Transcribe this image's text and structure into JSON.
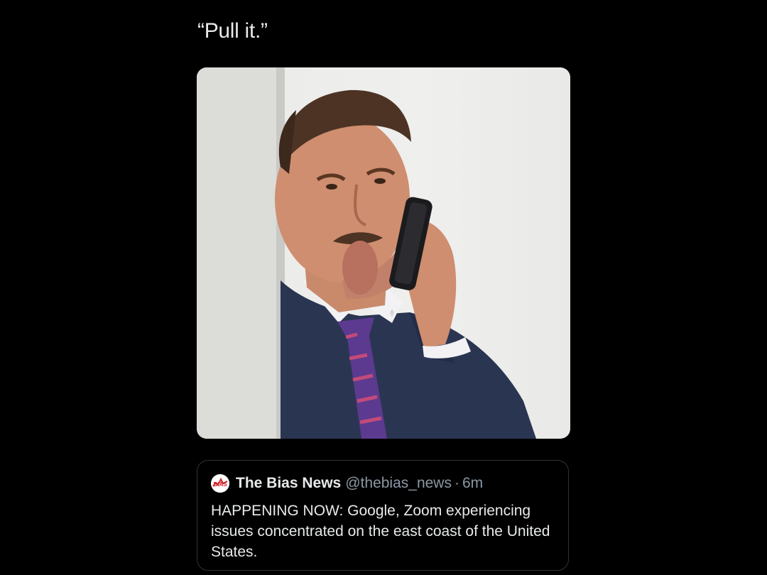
{
  "tweet": {
    "text": "“Pull it.”"
  },
  "media": {
    "alt": "Photo of a man in a navy suit and purple striped tie holding a phone to his ear, peeking around a white wall"
  },
  "quoted_tweet": {
    "avatar_text": "BIAS",
    "name": "The Bias News",
    "handle": "@thebias_news",
    "separator": "·",
    "time": "6m",
    "text": "HAPPENING NOW: Google, Zoom experiencing issues concentrated on the east coast of the United States."
  },
  "colors": {
    "background": "#000000",
    "text_primary": "#e7e9ea",
    "text_secondary": "#8b98a5",
    "card_border": "#2f3336",
    "avatar_red": "#d0242b"
  }
}
